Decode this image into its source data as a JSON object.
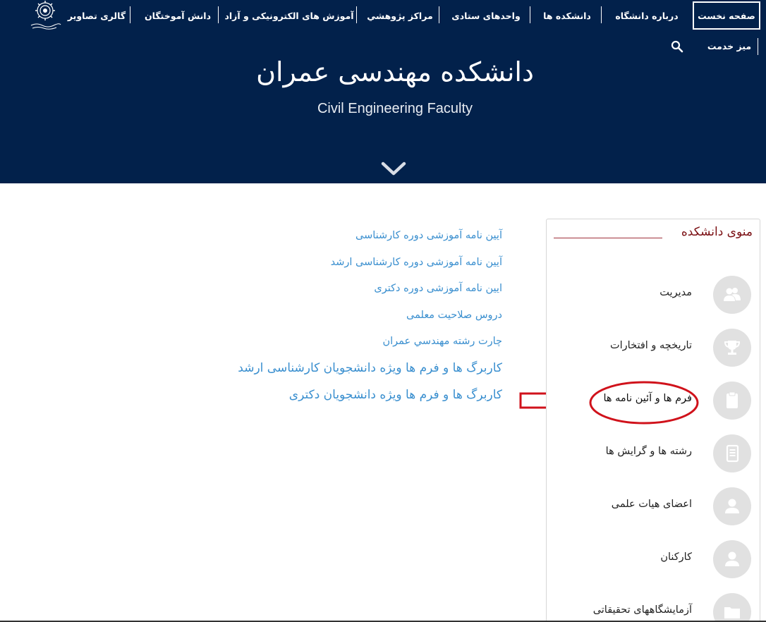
{
  "nav": {
    "items": [
      "صفحه نخست",
      "درباره دانشگاه",
      "دانشکده ها",
      "واحدهای ستادی",
      "مراکز پژوهشي",
      "آموزش های الکترونیکی و آزاد",
      "دانش آموختگان",
      "گالری تصاویر"
    ],
    "service_desk": "میز خدمت"
  },
  "header": {
    "title": "دانشکده مهندسی عمران",
    "subtitle": "Civil Engineering Faculty"
  },
  "links": [
    "آیین نامه آموزشی دوره کارشناسی",
    "آیین نامه آموزشی دوره کارشناسی ارشد",
    "ایین نامه آموزشی دوره دکتری",
    "دروس صلاحیت معلمی",
    "چارت رشته مهندسي عمران",
    "کاربرگ ها و فرم ها ویژه دانشجویان کارشناسی ارشد",
    "کاربرگ ها و فرم ها ویژه دانشجویان دکتری"
  ],
  "sidebar": {
    "title": "منوی دانشکده",
    "items": [
      {
        "label": "مدیریت",
        "icon": "users-icon"
      },
      {
        "label": "تاریخچه و افتخارات",
        "icon": "trophy-icon"
      },
      {
        "label": "فرم ها و آئین نامه ها",
        "icon": "clipboard-icon"
      },
      {
        "label": "رشته ها و گرایش ها",
        "icon": "document-list-icon"
      },
      {
        "label": "اعضای هیات علمی",
        "icon": "user-icon"
      },
      {
        "label": "کارکنان",
        "icon": "user-icon"
      },
      {
        "label": "آزمایشگاههای تحقیقاتی",
        "icon": "folder-icon"
      }
    ]
  },
  "colors": {
    "header_bg": "#02214b",
    "link": "#3a8fcf",
    "sidebar_title": "#7a0e12",
    "annotation": "#d0121b"
  }
}
